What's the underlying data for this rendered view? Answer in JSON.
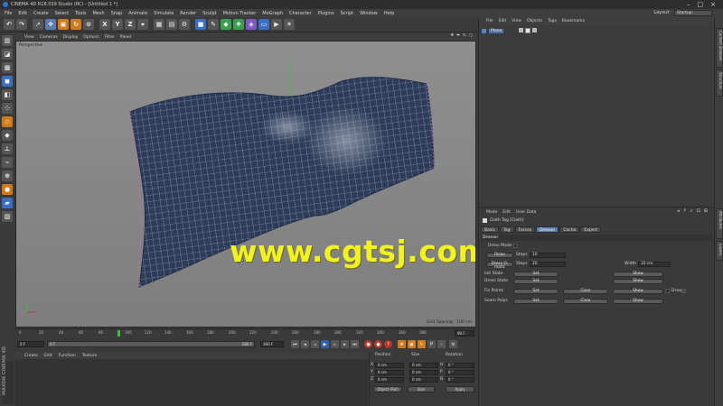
{
  "window": {
    "title": "CINEMA 4D R18.039 Studio (RC) - [Untitled 1 *]"
  },
  "menubar": [
    "File",
    "Edit",
    "Create",
    "Select",
    "Tools",
    "Mesh",
    "Snap",
    "Animate",
    "Simulate",
    "Render",
    "Sculpt",
    "Motion Tracker",
    "MoGraph",
    "Character",
    "Plugins",
    "Script",
    "Window",
    "Help"
  ],
  "layout": {
    "label": "Layout:",
    "value": "Startup"
  },
  "viewport": {
    "menu": [
      "View",
      "Cameras",
      "Display",
      "Options",
      "Filter",
      "Panel"
    ],
    "label": "Perspective",
    "grid_spacing": "Grid Spacing : 100 cm",
    "watermark": "www.cgtsj.com"
  },
  "timeline": {
    "ticks": [
      "0",
      "20",
      "40",
      "60",
      "80",
      "100",
      "120",
      "140",
      "160",
      "180",
      "200",
      "220",
      "240",
      "260",
      "280",
      "300",
      "320",
      "340",
      "360",
      "380"
    ],
    "playhead_frame": 90,
    "current_frame": "90 F",
    "start": "0 F",
    "range_start": "0 F",
    "range_end": "280 F",
    "end": "300 F"
  },
  "material_manager": {
    "menu": [
      "Create",
      "Edit",
      "Function",
      "Texture"
    ],
    "logo": "MAXON CINEMA 4D"
  },
  "coordinates": {
    "headers": [
      "Position",
      "Size",
      "Rotation"
    ],
    "rows": [
      {
        "axis": "X",
        "pos": "0 cm",
        "size": "0 cm",
        "rot_axis": "H",
        "rot": "0 °"
      },
      {
        "axis": "Y",
        "pos": "0 cm",
        "size": "0 cm",
        "rot_axis": "P",
        "rot": "0 °"
      },
      {
        "axis": "Z",
        "pos": "0 cm",
        "size": "0 cm",
        "rot_axis": "B",
        "rot": "0 °"
      }
    ],
    "mode": "Object (Rel)",
    "size_mode": "Size",
    "apply": "Apply"
  },
  "object_manager": {
    "menu": [
      "File",
      "Edit",
      "View",
      "Objects",
      "Tags",
      "Bookmarks"
    ],
    "object_name": "Plane"
  },
  "attribute_manager": {
    "menu": [
      "Mode",
      "Edit",
      "User Data"
    ],
    "title": "Cloth Tag [Cloth]",
    "tabs": [
      "Basic",
      "Tag",
      "Forces",
      "Dresser",
      "Cache",
      "Expert"
    ],
    "active_tab": "Dresser",
    "section": "Dresser",
    "dress_mode_label": "Dress Mode",
    "relax_button": "Relax",
    "steps_label": "Steps",
    "relax_steps": "10",
    "dress_omatic_button": "Dress-O-matic",
    "dress_steps": "20",
    "width_label": "Width",
    "width_value": "10 cm",
    "init_state_label": "Init State",
    "dress_state_label": "Dress State",
    "fix_points_label": "Fix Points",
    "seam_polys_label": "Seam Polys",
    "set": "Set",
    "show": "Show",
    "clear": "Clear",
    "draw_label": "Draw",
    "draw_check": "✓"
  },
  "right_strip": [
    "Content Browser",
    "Structure",
    "Attributes",
    "Layers"
  ],
  "colors": {
    "accent": "#5a7cb0",
    "watermark": "#f2f21e",
    "mesh": "#2d3c58",
    "playhead": "#3ac03a"
  },
  "icons": {
    "toolbar": [
      "undo-icon",
      "redo-icon",
      "live-selection-icon",
      "move-icon",
      "scale-icon",
      "rotate-icon",
      "recent-tools-icon",
      "x-axis-icon",
      "y-axis-icon",
      "z-axis-icon",
      "coordinate-system-icon",
      "render-view-icon",
      "render-picture-viewer-icon",
      "render-settings-icon",
      "cube-icon",
      "pen-icon",
      "subdivision-icon",
      "cloner-icon",
      "deformer-icon",
      "floor-icon",
      "camera-icon",
      "light-icon"
    ]
  }
}
